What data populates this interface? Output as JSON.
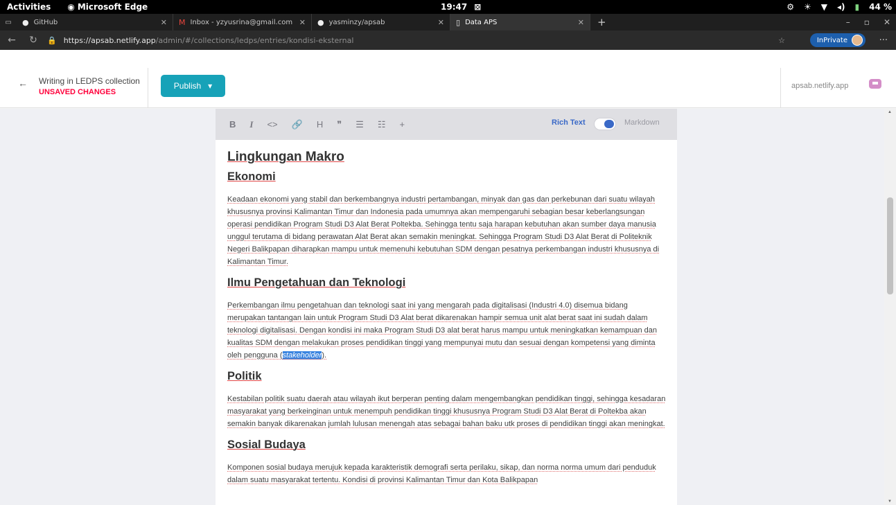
{
  "system": {
    "activities": "Activities",
    "app_name": "Microsoft Edge",
    "clock": "19:47",
    "battery": "44 %"
  },
  "tabs": [
    {
      "label": "GitHub",
      "icon": "github-icon"
    },
    {
      "label": "Inbox - yzyusrina@gmail.com",
      "icon": "gmail-icon"
    },
    {
      "label": "yasminzy/apsab",
      "icon": "github-icon"
    },
    {
      "label": "Data APS",
      "icon": "page-icon",
      "active": true
    }
  ],
  "address": {
    "host": "https://apsab.netlify.app",
    "path": "/admin/#/collections/ledps/entries/kondisi-eksternal",
    "private_label": "InPrivate"
  },
  "header": {
    "writing_in": "Writing in LEDPS collection",
    "unsaved": "UNSAVED CHANGES",
    "publish": "Publish",
    "site": "apsab.netlify.app"
  },
  "toolbar": {
    "rich_text": "Rich Text",
    "markdown": "Markdown",
    "tools": [
      "B",
      "I",
      "<>",
      "🔗",
      "H",
      "❞",
      "☰",
      "☷",
      "+"
    ]
  },
  "doc": {
    "title": "Lingkungan Makro",
    "s1_title": "Ekonomi",
    "s1_body": "Keadaan ekonomi yang stabil dan berkembangnya industri pertambangan, minyak dan gas dan perkebunan dari suatu wilayah khususnya provinsi Kalimantan Timur dan Indonesia pada umumnya akan mempengaruhi sebagian besar keberlangsungan operasi pendidikan Program Studi D3 Alat Berat Poltekba. Sehingga tentu saja harapan kebutuhan akan sumber daya manusia unggul terutama di bidang perawatan Alat Berat akan semakin meningkat. Sehingga Program Studi D3 Alat Berat di Politeknik Negeri Balikpapan diharapkan mampu untuk memenuhi kebutuhan SDM dengan pesatnya perkembangan industri khususnya di Kalimantan Timur.",
    "s2_title": "Ilmu Pengetahuan dan Teknologi",
    "s2_body": "Perkembangan ilmu pengetahuan dan teknologi saat ini yang mengarah pada digitalisasi (Industri 4.0) disemua bidang merupakan tantangan lain untuk Program Studi D3 Alat berat dikarenakan hampir semua unit alat berat saat ini sudah dalam teknologi digitalisasi. Dengan kondisi ini maka Program Studi D3 alat berat harus mampu untuk meningkatkan kemampuan dan kualitas SDM dengan melakukan proses pendidikan tinggi yang mempunyai mutu dan sesuai dengan kompetensi yang diminta oleh pengguna (",
    "s2_selected": "stakeholder",
    "s2_end": ").",
    "s3_title": "Politik",
    "s3_body": "Kestabilan politik suatu daerah atau wilayah ikut berperan penting dalam mengembangkan pendidikan tinggi, sehingga kesadaran masyarakat yang berkeinginan untuk menempuh pendidikan tinggi khususnya Program Studi D3 Alat Berat di Poltekba akan semakin banyak dikarenakan jumlah lulusan menengah atas sebagai bahan baku utk proses di pendidikan tinggi akan meningkat.",
    "s4_title": "Sosial Budaya",
    "s4_body": "Komponen sosial budaya merujuk kepada karakteristik demografi serta perilaku, sikap, dan norma norma umum dari penduduk dalam suatu masyarakat tertentu. Kondisi di provinsi Kalimantan Timur dan Kota Balikpapan"
  }
}
